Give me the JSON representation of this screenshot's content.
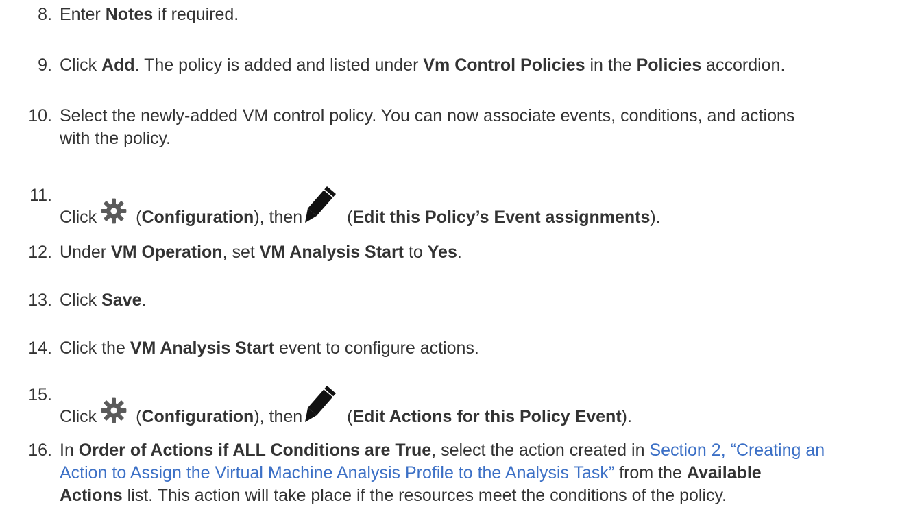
{
  "steps": [
    {
      "num": "8.",
      "parts": [
        "Enter ",
        "Notes",
        " if required."
      ]
    },
    {
      "num": "9.",
      "parts": [
        "Click ",
        "Add",
        ". The policy is added and listed under ",
        "Vm Control Policies",
        " in the ",
        "Policies",
        " accordion."
      ]
    },
    {
      "num": "10.",
      "line1": "Select the newly-added VM control policy. You can now associate events, conditions, and actions",
      "line2": "with the policy."
    },
    {
      "num": "11.",
      "click": "Click",
      "open1": " (",
      "config": "Configuration",
      "then": "), then",
      "open2": " (",
      "edit": "Edit this Policy’s Event assignments",
      "close": ")."
    },
    {
      "num": "12.",
      "parts": [
        "Under ",
        "VM Operation",
        ", set ",
        "VM Analysis Start",
        " to ",
        "Yes",
        "."
      ]
    },
    {
      "num": "13.",
      "parts": [
        "Click ",
        "Save",
        "."
      ]
    },
    {
      "num": "14.",
      "parts": [
        "Click the ",
        "VM Analysis Start",
        " event to configure actions."
      ]
    },
    {
      "num": "15.",
      "click": "Click",
      "open1": " (",
      "config": "Configuration",
      "then": "), then",
      "open2": " (",
      "edit": "Edit Actions for this Policy Event",
      "close": ")."
    },
    {
      "num": "16.",
      "p1": "In ",
      "b1": "Order of Actions if ALL Conditions are True",
      "p2": ", select the action created in ",
      "link1": "Section 2, “Creating an",
      "link2": "Action to Assign the Virtual Machine Analysis Profile to the Analysis Task”",
      "p3": " from the ",
      "b2": "Available",
      "b3": "Actions",
      "p4": " list. This action will take place if the resources meet the conditions of the policy."
    }
  ],
  "icons": {
    "gear": "gear-icon",
    "pencil": "pencil-icon"
  },
  "colors": {
    "text": "#333333",
    "link": "#3c70c6",
    "icon": "#5b5b5b"
  }
}
